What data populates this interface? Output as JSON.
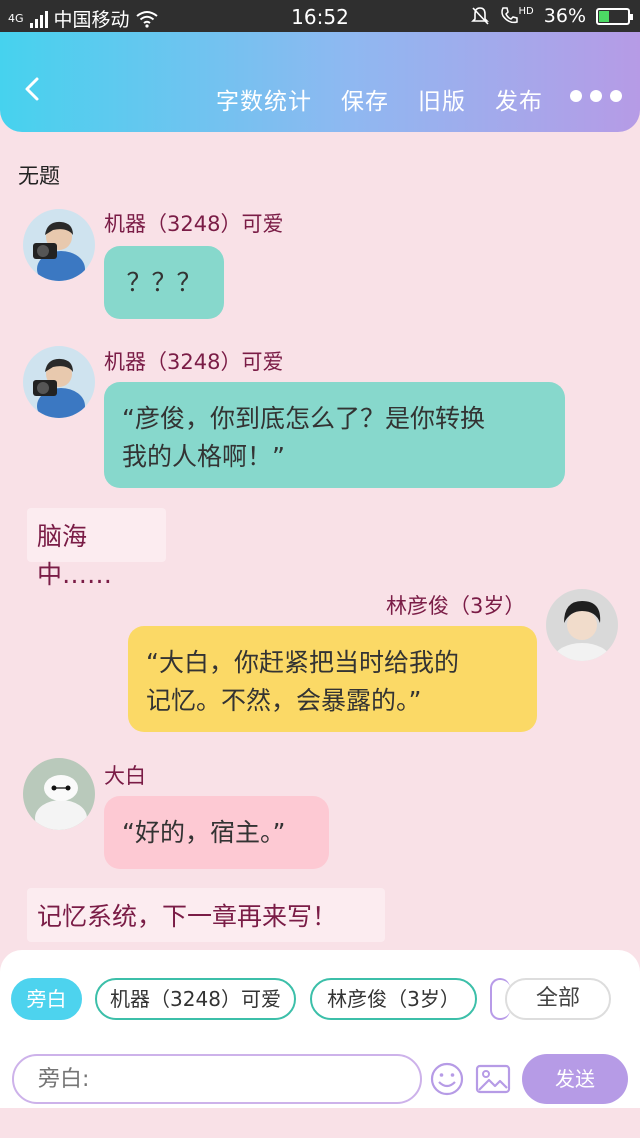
{
  "status_bar": {
    "network": "4G",
    "carrier": "中国移动",
    "time": "16:52",
    "hd": "HD",
    "battery": "36%",
    "battery_level": 0.36
  },
  "header": {
    "actions": [
      "字数统计",
      "保存",
      "旧版",
      "发布"
    ]
  },
  "doc_title": "无题",
  "messages": [
    {
      "speaker": "机器（3248）可爱",
      "text": "？？？"
    },
    {
      "speaker": "机器（3248）可爱",
      "text_lines": [
        "“彦俊，你到底怎么了？是你转换",
        "我的人格啊！”"
      ]
    },
    {
      "narration": "脑海中……"
    },
    {
      "speaker": "林彦俊（3岁）",
      "text_lines": [
        "“大白，你赶紧把当时给我的",
        "记忆。不然，会暴露的。”"
      ]
    },
    {
      "speaker": "大白",
      "text": "“好的，宿主。”"
    },
    {
      "narration": "记忆系统，下一章再来写！"
    }
  ],
  "composer": {
    "chips": [
      "旁白",
      "机器（3248）可爱",
      "林彦俊（3岁）",
      "全部"
    ],
    "placeholder": "旁白:",
    "send_label": "发送"
  },
  "colors": {
    "header_gradient": [
      "#46d2ee",
      "#8fb8f1",
      "#b69be6"
    ],
    "background": "#f9e1e7",
    "bubble_teal": "#87d8cc",
    "bubble_yellow": "#fbd966",
    "bubble_pink": "#fdc9d3",
    "accent_purple": "#b69be6",
    "name_color": "#7a1c46"
  }
}
